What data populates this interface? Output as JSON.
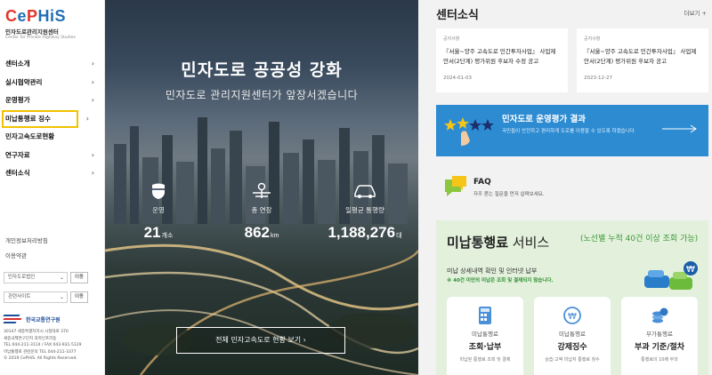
{
  "logo": {
    "main": "CePHiS",
    "kr": "민자도로관리지원센터",
    "en": "Center for Private Highway Studies"
  },
  "nav": [
    {
      "label": "센터소개"
    },
    {
      "label": "실시협약관리"
    },
    {
      "label": "운영평가"
    },
    {
      "label": "미납통행료 징수"
    },
    {
      "label": "민자고속도로현황"
    },
    {
      "label": "연구자료"
    },
    {
      "label": "센터소식"
    }
  ],
  "util": {
    "privacy": "개인정보처리방침",
    "terms": "이용약관"
  },
  "selects": [
    {
      "placeholder": "민자도로법인",
      "button": "이동"
    },
    {
      "placeholder": "관련사이트",
      "button": "이동"
    }
  ],
  "org": {
    "name": "한국교통연구원",
    "address_lines": [
      "30147 세종특별자치시 시청대로 370",
      "세종국책연구단지 과학인프라동",
      "TEL 044-211-3114 / FAX 043-931-5129",
      "미납통행료 관련문의 TEL 044-211-3377",
      "© 2019 CePHiS. All Rights Reserved."
    ]
  },
  "hero": {
    "title": "민자도로 공공성 강화",
    "subtitle": "민자도로 관리지원센터가 앞장서겠습니다",
    "stats": [
      {
        "label": "운영",
        "value": "21",
        "unit": "개소",
        "icon": "highway-shield-icon"
      },
      {
        "label": "총 연장",
        "value": "862",
        "unit": "km",
        "icon": "road-length-icon"
      },
      {
        "label": "일평균 통행량",
        "value": "1,188,276",
        "unit": "대",
        "icon": "car-icon"
      }
    ],
    "button": "전체 민자고속도로 현황 보기"
  },
  "news": {
    "heading": "센터소식",
    "more": "더보기 +",
    "items": [
      {
        "category": "공지사항",
        "title": "『서울~양주 고속도로 민간투자사업』 사업제안서(2단계) 평가위원 후보자 수정 공고",
        "date": "2024-01-03"
      },
      {
        "category": "공지사항",
        "title": "『서울~양주 고속도로 민간투자사업』 사업제안서(2단계) 평가위원 후보자 공고",
        "date": "2023-12-27"
      }
    ]
  },
  "banner": {
    "title": "민자도로 운영평가 결과",
    "desc": "국민들이 안전하고 편리하게 도로를 이용할 수 있도록 하겠습니다",
    "color": "#2d8bd2"
  },
  "faq": {
    "title": "FAQ",
    "desc": "자주 묻는 질문을 먼저 살펴보세요."
  },
  "unpaid": {
    "title_bold": "미납통행료",
    "title_rest": "서비스",
    "note": "(노선별 누적 40건 이상 조회 가능)",
    "desc": "미납 상세내역 확인 및 인터넷 납부",
    "desc2": "※ 40건 미만의 미납은 조회 및 결제되지 않습니다.",
    "services": [
      {
        "sub": "미납통행료",
        "main": "조회·납부",
        "desc": "미납된 통행료 조회 및 결제"
      },
      {
        "sub": "미납통행료",
        "main": "강제징수",
        "desc": "상습·고액 미납자 통행료 징수"
      },
      {
        "sub": "부가통행료",
        "main": "부과 기준/절차",
        "desc": "통행료의 10배 부과"
      }
    ]
  }
}
